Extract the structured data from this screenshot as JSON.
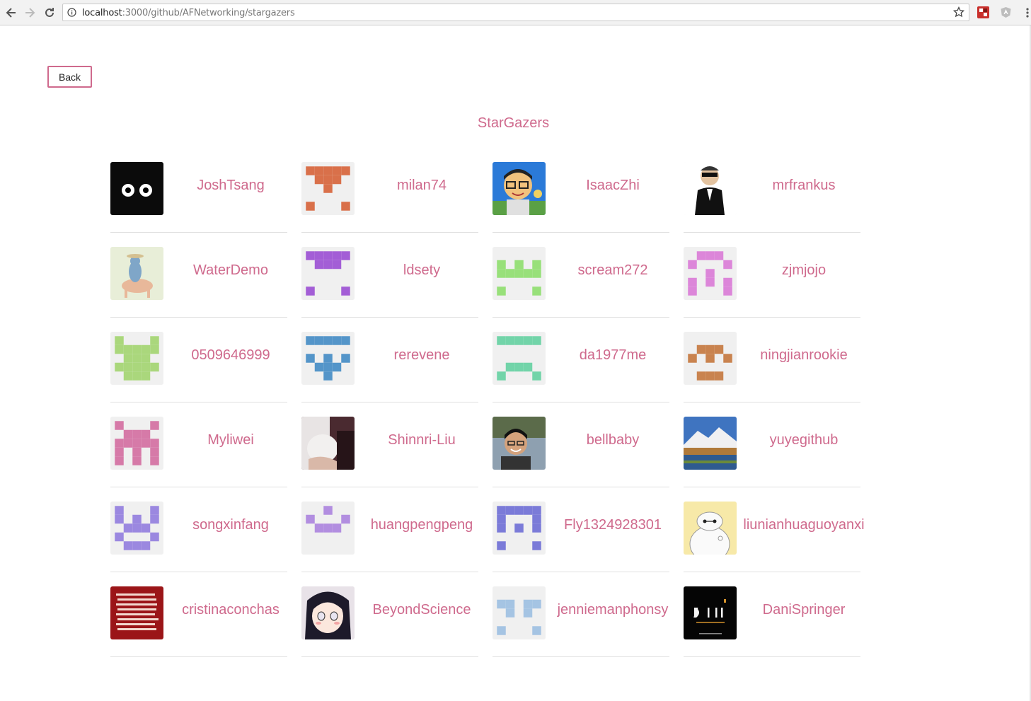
{
  "browser": {
    "url_host": "localhost",
    "url_path": ":3000/github/AFNetworking/stargazers"
  },
  "page": {
    "back_label": "Back",
    "title": "StarGazers"
  },
  "stargazers": [
    {
      "username": "JoshTsang",
      "avatar_type": "photo",
      "avatar_desc": "black-cartoon-eyes"
    },
    {
      "username": "milan74",
      "avatar_type": "identicon",
      "color": "#d9704a"
    },
    {
      "username": "IsaacZhi",
      "avatar_type": "photo",
      "avatar_desc": "cartoon-man-glasses"
    },
    {
      "username": "mrfrankus",
      "avatar_type": "photo",
      "avatar_desc": "man-in-suit"
    },
    {
      "username": "WaterDemo",
      "avatar_type": "photo",
      "avatar_desc": "cartoon-rider"
    },
    {
      "username": "ldsety",
      "avatar_type": "identicon",
      "color": "#a35ed6"
    },
    {
      "username": "scream272",
      "avatar_type": "identicon",
      "color": "#98e07a"
    },
    {
      "username": "zjmjojo",
      "avatar_type": "identicon",
      "color": "#dc86d9"
    },
    {
      "username": "0509646999",
      "avatar_type": "identicon",
      "color": "#aad77c"
    },
    {
      "username": "rerevene",
      "avatar_type": "identicon",
      "color": "#5495c9"
    },
    {
      "username": "da1977me",
      "avatar_type": "identicon",
      "color": "#72d4a9"
    },
    {
      "username": "ningjianrookie",
      "avatar_type": "identicon",
      "color": "#c9834f"
    },
    {
      "username": "Myliwei",
      "avatar_type": "identicon",
      "color": "#d67aa8"
    },
    {
      "username": "Shinnri-Liu",
      "avatar_type": "photo",
      "avatar_desc": "photo-person"
    },
    {
      "username": "bellbaby",
      "avatar_type": "photo",
      "avatar_desc": "photo-man-smiling"
    },
    {
      "username": "yuyegithub",
      "avatar_type": "photo",
      "avatar_desc": "landscape-mountain"
    },
    {
      "username": "songxinfang",
      "avatar_type": "identicon",
      "color": "#9b88e0"
    },
    {
      "username": "huangpengpeng",
      "avatar_type": "identicon",
      "color": "#b28ee0"
    },
    {
      "username": "Fly1324928301",
      "avatar_type": "identicon",
      "color": "#7b7bd8"
    },
    {
      "username": "liunianhuaguoyanxi",
      "avatar_type": "photo",
      "avatar_desc": "baymax"
    },
    {
      "username": "cristinaconchas",
      "avatar_type": "photo",
      "avatar_desc": "red-text-card"
    },
    {
      "username": "BeyondScience",
      "avatar_type": "photo",
      "avatar_desc": "anime-girl"
    },
    {
      "username": "jenniemanphonsy",
      "avatar_type": "identicon",
      "color": "#a5c4e3"
    },
    {
      "username": "DaniSpringer",
      "avatar_type": "photo",
      "avatar_desc": "dani-logo"
    }
  ],
  "colors": {
    "accent": "#cf6a8d",
    "divider": "#e0e0e0",
    "avatar_bg": "#f0f0f0"
  }
}
